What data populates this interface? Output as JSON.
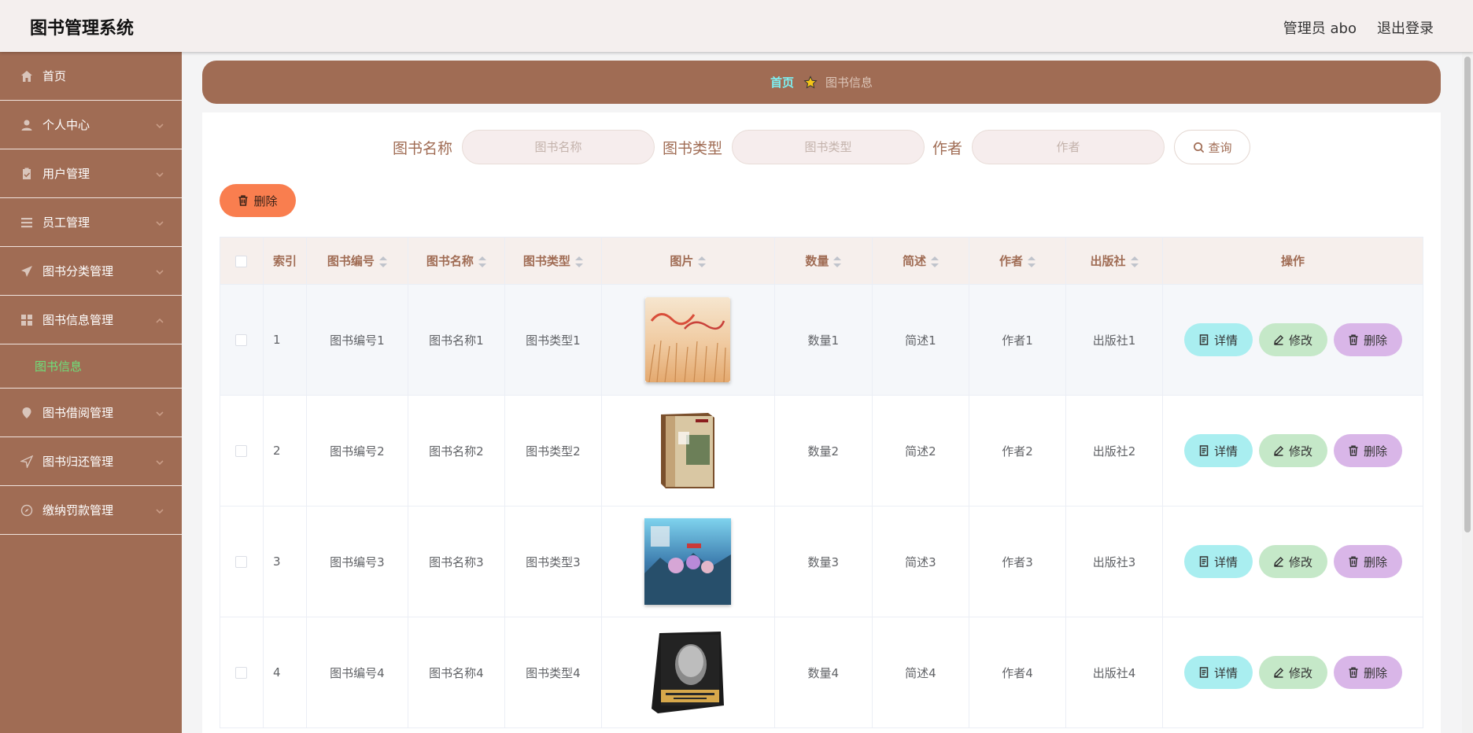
{
  "header": {
    "title": "图书管理系统",
    "user": "管理员 abo",
    "logout": "退出登录"
  },
  "sidebar": {
    "items": [
      {
        "label": "首页",
        "icon": "home-icon"
      },
      {
        "label": "个人中心",
        "icon": "user-icon"
      },
      {
        "label": "用户管理",
        "icon": "clipboard-icon"
      },
      {
        "label": "员工管理",
        "icon": "list-icon"
      },
      {
        "label": "图书分类管理",
        "icon": "send-icon"
      },
      {
        "label": "图书信息管理",
        "icon": "grid-icon"
      },
      {
        "label": "图书借阅管理",
        "icon": "location-icon"
      },
      {
        "label": "图书归还管理",
        "icon": "navigation-icon"
      },
      {
        "label": "缴纳罚款管理",
        "icon": "compass-icon"
      }
    ],
    "active_sub": "图书信息"
  },
  "breadcrumb": {
    "home": "首页",
    "current": "图书信息"
  },
  "search": {
    "name_label": "图书名称",
    "name_placeholder": "图书名称",
    "type_label": "图书类型",
    "type_placeholder": "图书类型",
    "author_label": "作者",
    "author_placeholder": "作者",
    "query_label": "查询"
  },
  "delete_label": "删除",
  "table": {
    "columns": [
      "索引",
      "图书编号",
      "图书名称",
      "图书类型",
      "图片",
      "数量",
      "简述",
      "作者",
      "出版社",
      "操作"
    ],
    "rows": [
      {
        "index": "1",
        "code": "图书编号1",
        "name": "图书名称1",
        "type": "图书类型1",
        "qty": "数量1",
        "desc": "简述1",
        "author": "作者1",
        "publisher": "出版社1"
      },
      {
        "index": "2",
        "code": "图书编号2",
        "name": "图书名称2",
        "type": "图书类型2",
        "qty": "数量2",
        "desc": "简述2",
        "author": "作者2",
        "publisher": "出版社2"
      },
      {
        "index": "3",
        "code": "图书编号3",
        "name": "图书名称3",
        "type": "图书类型3",
        "qty": "数量3",
        "desc": "简述3",
        "author": "作者3",
        "publisher": "出版社3"
      },
      {
        "index": "4",
        "code": "图书编号4",
        "name": "图书名称4",
        "type": "图书类型4",
        "qty": "数量4",
        "desc": "简述4",
        "author": "作者4",
        "publisher": "出版社4"
      }
    ],
    "actions": {
      "detail": "详情",
      "edit": "修改",
      "delete": "删除"
    }
  },
  "colors": {
    "brand": "#a06c54",
    "breadcrumb_home": "#7ef0f2",
    "active_sub": "#6ee07a",
    "delete": "#f97e4f"
  }
}
